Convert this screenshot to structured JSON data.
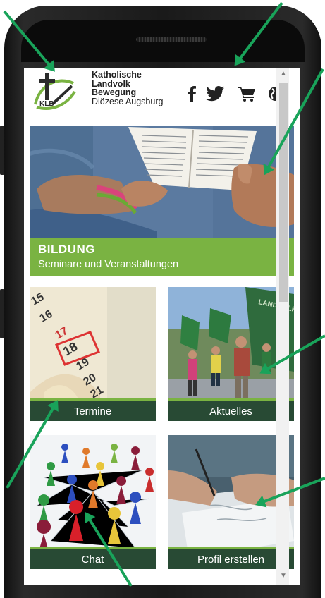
{
  "brand": {
    "line1": "Katholische",
    "line2": "Landvolk",
    "line3": "Bewegung",
    "line4": "Diözese Augsburg",
    "logo_text": "KLB"
  },
  "social": {
    "facebook_icon": "facebook-icon",
    "twitter_icon": "twitter-icon",
    "cart_icon": "cart-icon",
    "globe_icon": "globe-icon"
  },
  "hero": {
    "title": "BILDUNG",
    "subtitle": "Seminare und Veranstaltungen"
  },
  "tiles": [
    {
      "label": "Termine"
    },
    {
      "label": "Aktuelles"
    },
    {
      "label": "Chat"
    },
    {
      "label": "Profil erstellen"
    }
  ],
  "calendar_numbers": [
    "15",
    "16",
    "17",
    "18",
    "19",
    "20",
    "21"
  ],
  "flag_text": "LANDVOLK",
  "colors": {
    "accent_green": "#7ab342",
    "tile_bar": "#284a34",
    "arrow_green": "#19a35a"
  }
}
